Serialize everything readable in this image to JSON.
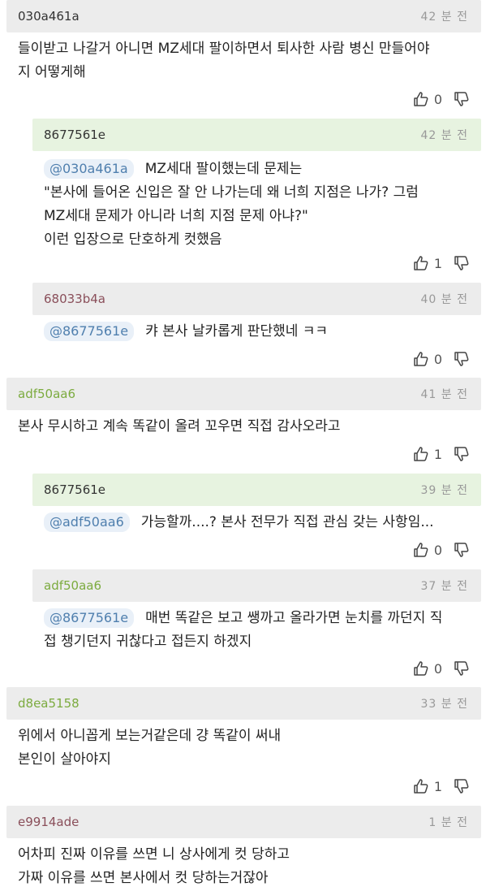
{
  "comments": [
    {
      "nick": "030a461a",
      "time": "42 분 전",
      "mention": "",
      "lines": [
        "들이받고 나갈거 아니면 MZ세대 팔이하면서 퇴사한 사람 병신 만들어야",
        "지 어떻게해"
      ],
      "up": "0"
    },
    {
      "nick": "8677561e",
      "time": "42 분 전",
      "mention": "@030a461a",
      "lines": [
        "MZ세대 팔이했는데 문제는",
        "\"본사에 들어온 신입은 잘 안 나가는데 왜 너희 지점은 나가? 그럼",
        "MZ세대 문제가 아니라 너희 지점 문제 아냐?\"",
        "이런 입장으로 단호하게 컷했음"
      ],
      "up": "1"
    },
    {
      "nick": "68033b4a",
      "time": "40 분 전",
      "mention": "@8677561e",
      "lines": [
        "캬 본사 날카롭게 판단했네 ㅋㅋ"
      ],
      "up": "0"
    },
    {
      "nick": "adf50aa6",
      "time": "41 분 전",
      "mention": "",
      "lines": [
        "본사 무시하고 계속 똑같이 올려 꼬우면 직접 감사오라고"
      ],
      "up": "1"
    },
    {
      "nick": "8677561e",
      "time": "39 분 전",
      "mention": "@adf50aa6",
      "lines": [
        "가능할까....? 본사 전무가 직접 관심 갖는 사항임..."
      ],
      "up": "0"
    },
    {
      "nick": "adf50aa6",
      "time": "37 분 전",
      "mention": "@8677561e",
      "lines": [
        "매번 똑같은 보고 쌩까고 올라가면 눈치를 까던지 직",
        "접 챙기던지 귀찮다고 접든지 하겠지"
      ],
      "up": "0"
    },
    {
      "nick": "d8ea5158",
      "time": "33 분 전",
      "mention": "",
      "lines": [
        "위에서 아니꼽게 보는거같은데 걍 똑같이 써내",
        "본인이 살아야지"
      ],
      "up": "1"
    },
    {
      "nick": "e9914ade",
      "time": "1 분 전",
      "mention": "",
      "lines": [
        "어차피 진짜 이유를 쓰면 니 상사에게 컷 당하고",
        "가짜 이유를 쓰면 본사에서 컷 당하는거잖아"
      ],
      "up": ""
    }
  ],
  "colors": {
    "header_gray": "#ececec",
    "header_green": "#e7f3e0",
    "nick_green": "#7cab3f",
    "nick_red": "#8a4f5a",
    "mention_text": "#4f7fae"
  },
  "icons": {
    "like": "thumbs-up-icon",
    "dislike": "thumbs-down-icon"
  }
}
